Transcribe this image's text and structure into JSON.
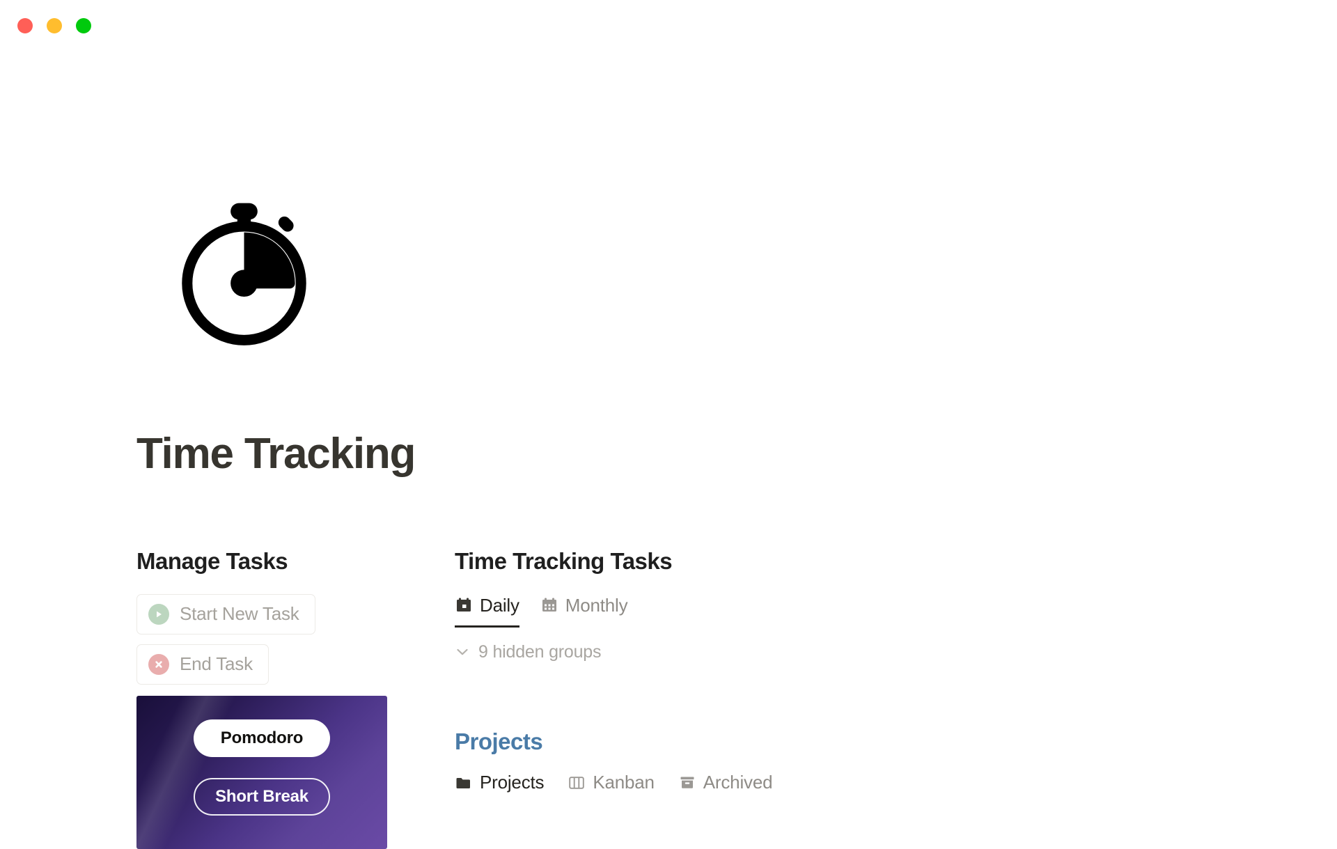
{
  "window": {
    "traffic_lights": [
      {
        "name": "close",
        "color": "#ff5f57"
      },
      {
        "name": "minimize",
        "color": "#ffbd2e"
      },
      {
        "name": "maximize",
        "color": "#00ca0d"
      }
    ]
  },
  "hero": {
    "icon": "stopwatch-icon",
    "icon_color": "#000000"
  },
  "page_title": "Time Tracking",
  "manage_tasks": {
    "heading": "Manage Tasks",
    "actions": [
      {
        "label": "Start New Task",
        "icon": "play-circle-icon",
        "icon_bg": "#bcd6bf"
      },
      {
        "label": "End Task",
        "icon": "close-circle-icon",
        "icon_bg": "#e9adad"
      }
    ]
  },
  "pomodoro": {
    "buttons": [
      {
        "label": "Pomodoro",
        "style": "solid"
      },
      {
        "label": "Short Break",
        "style": "outline"
      }
    ],
    "gradient_from": "#190f3a",
    "gradient_to": "#6a4aa6"
  },
  "time_tracking_tasks": {
    "heading": "Time Tracking Tasks",
    "tabs": [
      {
        "label": "Daily",
        "icon": "calendar-day-icon",
        "active": true
      },
      {
        "label": "Monthly",
        "icon": "calendar-month-icon",
        "active": false
      }
    ],
    "hidden_groups": {
      "label": "9 hidden groups",
      "icon": "chevron-down-icon"
    }
  },
  "projects": {
    "heading": "Projects",
    "heading_color": "#4a7ba7",
    "tabs": [
      {
        "label": "Projects",
        "icon": "folder-icon",
        "active": true
      },
      {
        "label": "Kanban",
        "icon": "board-icon",
        "active": false
      },
      {
        "label": "Archived",
        "icon": "archive-icon",
        "active": false
      }
    ]
  }
}
